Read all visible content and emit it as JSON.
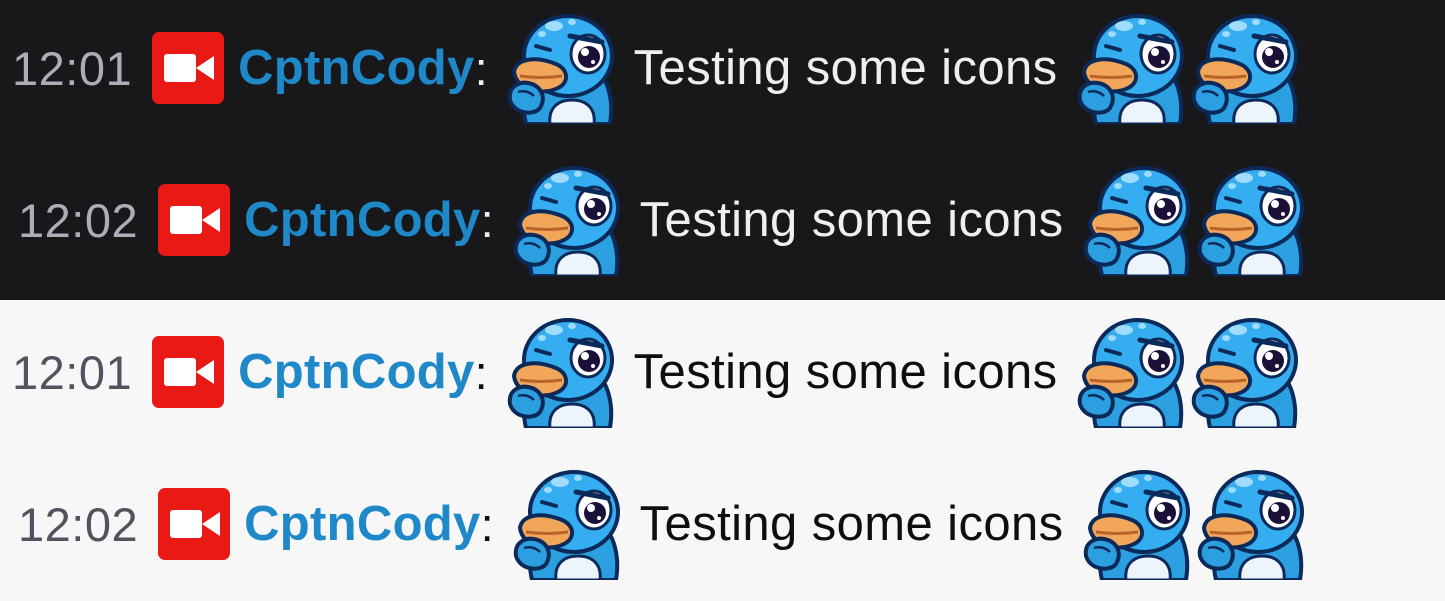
{
  "theme_colors": {
    "dark_background": "#18181b",
    "light_background": "#f7f7f8",
    "username_color": "#1e88c8",
    "badge_color": "#e91916"
  },
  "icons": {
    "badge": "video-camera-badge-icon",
    "emote": "thinking-duck-emote-icon"
  },
  "dark_panel": {
    "messages": [
      {
        "timestamp": "12:01",
        "username": "CptnCody",
        "colon": ":",
        "text": "Testing some icons"
      },
      {
        "timestamp": "12:02",
        "username": "CptnCody",
        "colon": ":",
        "text": "Testing some icons"
      }
    ]
  },
  "light_panel": {
    "messages": [
      {
        "timestamp": "12:01",
        "username": "CptnCody",
        "colon": ":",
        "text": "Testing some icons"
      },
      {
        "timestamp": "12:02",
        "username": "CptnCody",
        "colon": ":",
        "text": "Testing some icons"
      }
    ]
  }
}
